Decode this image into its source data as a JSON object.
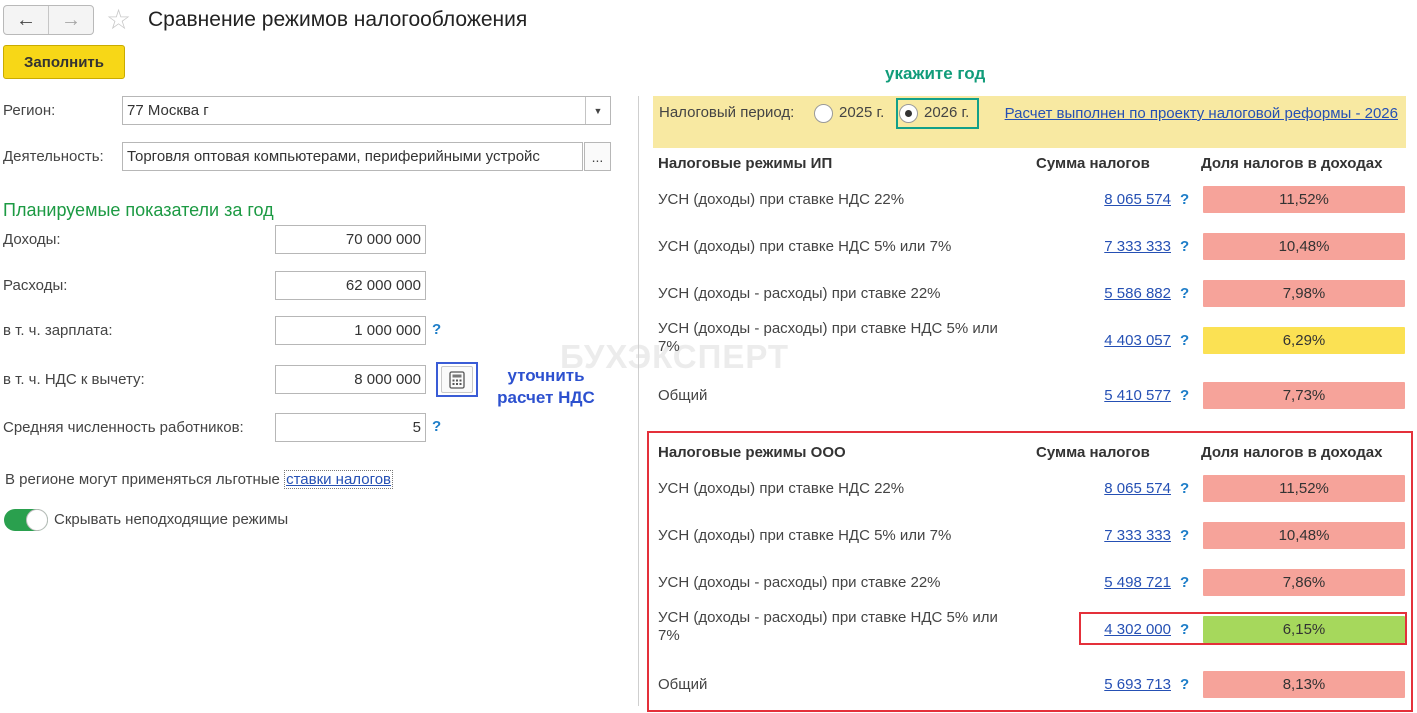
{
  "window": {
    "title": "Сравнение режимов налогообложения"
  },
  "toolbar": {
    "back_icon": "←",
    "forward_icon": "→",
    "star_icon": "☆",
    "fill_label": "Заполнить"
  },
  "form": {
    "region_label": "Регион:",
    "region_value": "77 Москва г",
    "activity_label": "Деятельность:",
    "activity_value": "Торговля оптовая компьютерами, периферийными устройс",
    "ellipsis": "...",
    "section_title": "Планируемые показатели за год",
    "income_label": "Доходы:",
    "income_value": "70 000 000",
    "expenses_label": "Расходы:",
    "expenses_value": "62 000 000",
    "salary_label": "в т. ч. зарплата:",
    "salary_value": "1 000 000",
    "vat_label": "в т. ч. НДС к вычету:",
    "vat_value": "8 000 000",
    "employees_label": "Средняя численность работников:",
    "employees_value": "5",
    "help_mark": "?",
    "preferential_text": "В регионе могут применяться льготные",
    "preferential_link": "ставки налогов",
    "hide_toggle_label": "Скрывать неподходящие режимы",
    "hide_toggle_on": true
  },
  "annotations": {
    "refine_vat": "уточнить расчет НДС",
    "specify_year": "укажите год"
  },
  "period": {
    "label": "Налоговый период:",
    "options": [
      "2025 г.",
      "2026 г."
    ],
    "selected": "2026 г.",
    "reform_link": "Расчет выполнен по проекту налоговой реформы - 2026"
  },
  "columns": {
    "sum": "Сумма налогов",
    "share": "Доля налогов в доходах"
  },
  "ip": {
    "header": "Налоговые режимы ИП",
    "rows": [
      {
        "mode": "УСН (доходы) при ставке НДС 22%",
        "amount": "8 065 574",
        "share": "11,52%",
        "color": "#f6a39a"
      },
      {
        "mode": "УСН (доходы) при ставке НДС 5% или 7%",
        "amount": "7 333 333",
        "share": "10,48%",
        "color": "#f6a39a"
      },
      {
        "mode": "УСН (доходы - расходы) при ставке 22%",
        "amount": "5 586 882",
        "share": "7,98%",
        "color": "#f6a39a"
      },
      {
        "mode": "УСН (доходы - расходы) при ставке НДС 5% или 7%",
        "amount": "4 403 057",
        "share": "6,29%",
        "color": "#fbe153"
      },
      {
        "mode": "Общий",
        "amount": "5 410 577",
        "share": "7,73%",
        "color": "#f6a39a"
      }
    ]
  },
  "ooo": {
    "header": "Налоговые режимы ООО",
    "rows": [
      {
        "mode": "УСН (доходы) при ставке НДС 22%",
        "amount": "8 065 574",
        "share": "11,52%",
        "color": "#f6a39a"
      },
      {
        "mode": "УСН (доходы) при ставке НДС 5% или 7%",
        "amount": "7 333 333",
        "share": "10,48%",
        "color": "#f6a39a"
      },
      {
        "mode": "УСН (доходы - расходы) при ставке 22%",
        "amount": "5 498 721",
        "share": "7,86%",
        "color": "#f6a39a"
      },
      {
        "mode": "УСН (доходы - расходы) при ставке НДС 5% или 7%",
        "amount": "4 302 000",
        "share": "6,15%",
        "color": "#a6d85c"
      },
      {
        "mode": "Общий",
        "amount": "5 693 713",
        "share": "8,13%",
        "color": "#f6a39a"
      }
    ]
  },
  "watermark": "БУХЭКСПЕРТ"
}
